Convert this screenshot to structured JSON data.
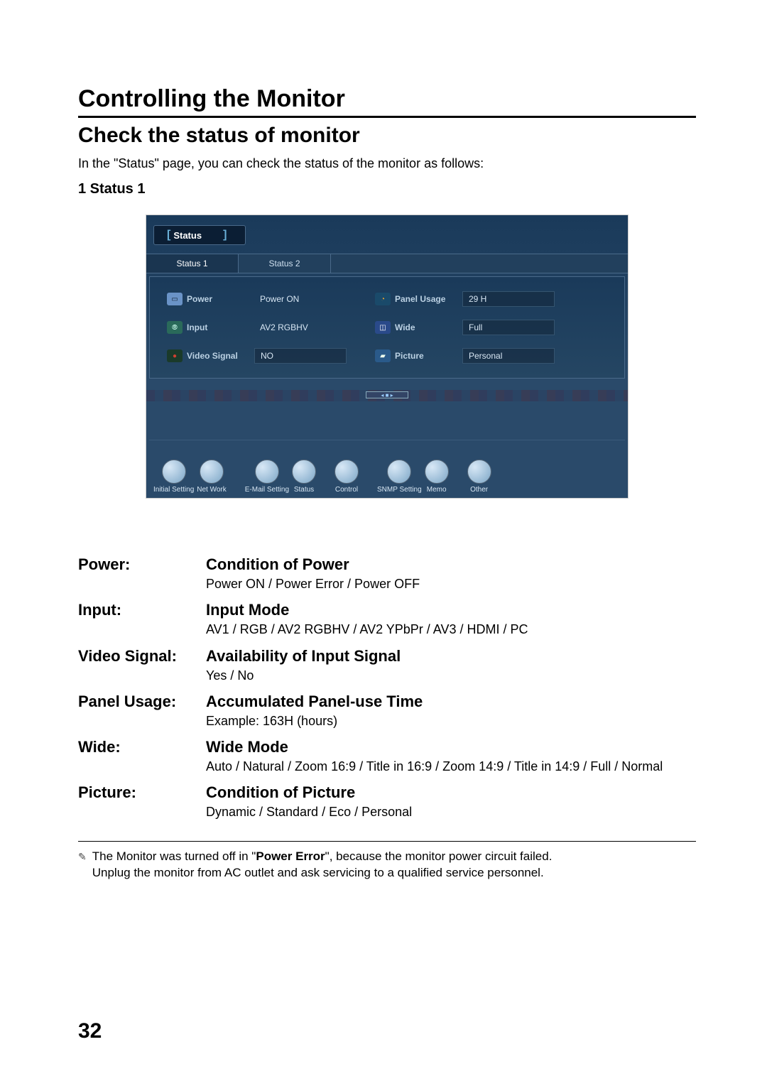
{
  "title": "Controlling the Monitor",
  "subtitle": "Check the status of monitor",
  "intro": "In the \"Status\" page, you can check the status of the monitor as follows:",
  "section_label": "1 Status 1",
  "screenshot": {
    "main_tab": "Status",
    "sub_tabs": [
      "Status 1",
      "Status 2"
    ],
    "rows": [
      {
        "left_label": "Power",
        "left_value": "Power ON",
        "right_label": "Panel Usage",
        "right_value": "29 H"
      },
      {
        "left_label": "Input",
        "left_value": "AV2 RGBHV",
        "right_label": "Wide",
        "right_value": "Full"
      },
      {
        "left_label": "Video Signal",
        "left_value": "NO",
        "right_label": "Picture",
        "right_value": "Personal"
      }
    ],
    "bottom_icons": [
      "Initial Setting",
      "Net Work",
      "E-Mail Setting",
      "Status",
      "Control",
      "SNMP Setting",
      "Memo",
      "Other"
    ]
  },
  "definitions": [
    {
      "term": "Power:",
      "heading": "Condition of Power",
      "detail": "Power ON / Power Error / Power OFF"
    },
    {
      "term": "Input:",
      "heading": "Input Mode",
      "detail": "AV1 / RGB / AV2 RGBHV / AV2 YPbPr / AV3 / HDMI / PC"
    },
    {
      "term": "Video Signal:",
      "heading": "Availability of Input Signal",
      "detail": "Yes / No"
    },
    {
      "term": "Panel Usage:",
      "heading": "Accumulated Panel-use Time",
      "detail": "Example: 163H (hours)"
    },
    {
      "term": "Wide:",
      "heading": "Wide Mode",
      "detail": "Auto / Natural / Zoom 16:9 / Title in 16:9 / Zoom 14:9 / Title in 14:9 / Full / Normal"
    },
    {
      "term": "Picture:",
      "heading": "Condition of Picture",
      "detail": "Dynamic / Standard / Eco / Personal"
    }
  ],
  "note": {
    "line1_pre": "The Monitor was turned off in \"",
    "line1_bold": "Power Error",
    "line1_post": "\", because the monitor power circuit failed.",
    "line2": "Unplug the monitor from AC outlet and ask servicing to a qualified service personnel."
  },
  "page_number": "32"
}
